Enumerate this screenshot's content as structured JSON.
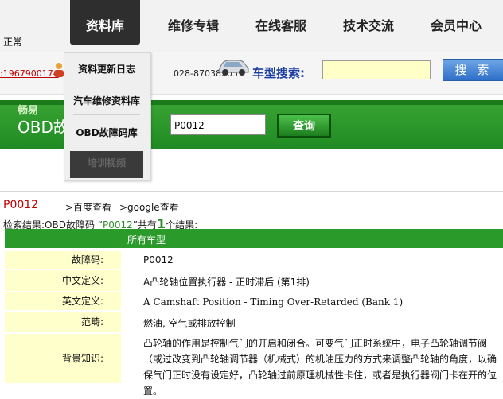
{
  "status_text": "正常",
  "nav": {
    "library": "资料库",
    "repair": "维修专辑",
    "service": "在线客服",
    "tech": "技术交流",
    "member": "会员中心"
  },
  "bar2": {
    "phone_red": ":1967900174",
    "phone_2": "028-87038205",
    "search_label": "车型搜索:",
    "search_value": "",
    "search_button": "搜 索"
  },
  "dropdown": {
    "items": [
      "资料更新日志",
      "汽车维修资料库",
      "OBD故障码库",
      "培训视频"
    ]
  },
  "banner": {
    "brand": "畅易",
    "title": "OBD故障码查询",
    "input_value": "P0012",
    "query_button": "查询"
  },
  "result": {
    "code": "P0012",
    "baidu": ">百度查看",
    "google": ">google查看",
    "prefix": "检索结果:OBD故障码 “",
    "query": "P0012",
    "mid": "”共有",
    "count": "1",
    "suffix": "个结果:",
    "header": "所有车型"
  },
  "rows": [
    {
      "label": "故障码:",
      "value": "P0012"
    },
    {
      "label": "中文定义:",
      "value": "A凸轮轴位置执行器 - 正时滞后 (第1排)"
    },
    {
      "label": "英文定义:",
      "value": "A Camshaft Position - Timing Over-Retarded (Bank 1)"
    },
    {
      "label": "范畴:",
      "value": "燃油, 空气或排放控制"
    },
    {
      "label": "背景知识:",
      "value": "凸轮轴的作用是控制气门的开启和闭合。可变气门正时系统中，电子凸轮轴调节阀（或过改变到凸轮轴调节器（机械式）的机油压力的方式来调整凸轮轴的角度，以确保气门正时没有设定好，凸轮轴过前原理机械性卡住，或者是执行器阀门卡在开的位置。"
    }
  ]
}
